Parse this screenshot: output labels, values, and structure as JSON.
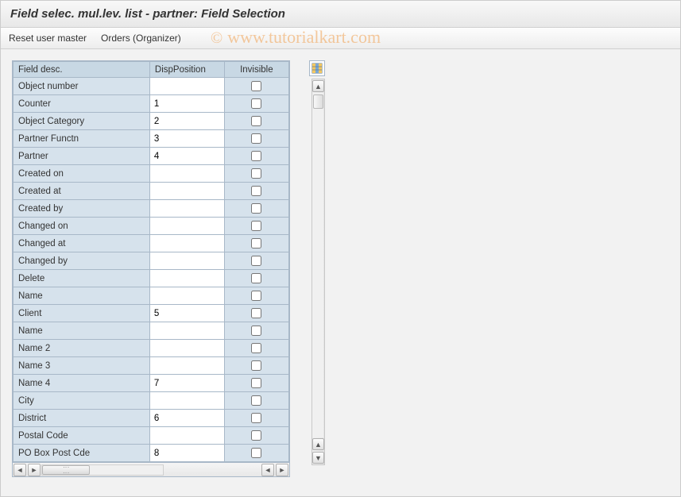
{
  "title": "Field selec. mul.lev. list - partner: Field Selection",
  "toolbar": {
    "reset_user_master": "Reset user master",
    "orders_organizer": "Orders (Organizer)"
  },
  "columns": {
    "field_desc": "Field desc.",
    "disp_position": "DispPosition",
    "invisible": "Invisible"
  },
  "rows": [
    {
      "label": "Object number",
      "pos": "",
      "inv": false
    },
    {
      "label": "Counter",
      "pos": "1",
      "inv": false
    },
    {
      "label": "Object Category",
      "pos": "2",
      "inv": false
    },
    {
      "label": "Partner Functn",
      "pos": "3",
      "inv": false
    },
    {
      "label": "Partner",
      "pos": "4",
      "inv": false
    },
    {
      "label": "Created on",
      "pos": "",
      "inv": false
    },
    {
      "label": "Created at",
      "pos": "",
      "inv": false
    },
    {
      "label": "Created by",
      "pos": "",
      "inv": false
    },
    {
      "label": "Changed on",
      "pos": "",
      "inv": false
    },
    {
      "label": "Changed at",
      "pos": "",
      "inv": false
    },
    {
      "label": "Changed by",
      "pos": "",
      "inv": false
    },
    {
      "label": "Delete",
      "pos": "",
      "inv": false
    },
    {
      "label": "Name",
      "pos": "",
      "inv": false
    },
    {
      "label": "Client",
      "pos": "5",
      "inv": false
    },
    {
      "label": "Name",
      "pos": "",
      "inv": false
    },
    {
      "label": "Name 2",
      "pos": "",
      "inv": false
    },
    {
      "label": "Name 3",
      "pos": "",
      "inv": false
    },
    {
      "label": "Name 4",
      "pos": "7",
      "inv": false
    },
    {
      "label": "City",
      "pos": "",
      "inv": false
    },
    {
      "label": "District",
      "pos": "6",
      "inv": false
    },
    {
      "label": "Postal Code",
      "pos": "",
      "inv": false
    },
    {
      "label": "PO Box Post Cde",
      "pos": "8",
      "inv": false
    }
  ],
  "watermark": {
    "copy": "©",
    "text": "www.tutorialkart.com"
  }
}
